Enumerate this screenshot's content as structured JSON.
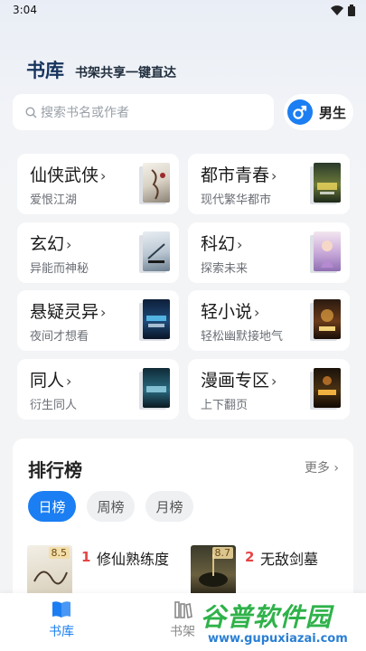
{
  "status": {
    "time": "3:04"
  },
  "header": {
    "title": "书库",
    "slogan": "书架共享一键直达"
  },
  "search": {
    "placeholder": "搜索书名或作者"
  },
  "gender": {
    "label": "男生",
    "symbol": "♂"
  },
  "categories": [
    {
      "name": "仙侠武侠",
      "sub": "爱恨江湖"
    },
    {
      "name": "都市青春",
      "sub": "现代繁华都市"
    },
    {
      "name": "玄幻",
      "sub": "异能而神秘"
    },
    {
      "name": "科幻",
      "sub": "探索未来"
    },
    {
      "name": "悬疑灵异",
      "sub": "夜间才想看"
    },
    {
      "name": "轻小说",
      "sub": "轻松幽默接地气"
    },
    {
      "name": "同人",
      "sub": "衍生同人"
    },
    {
      "name": "漫画专区",
      "sub": "上下翻页"
    }
  ],
  "ranking": {
    "title": "排行榜",
    "more": "更多",
    "tabs": [
      "日榜",
      "周榜",
      "月榜"
    ],
    "books": [
      {
        "rank": "1",
        "title": "修仙熟练度",
        "score": "8.5"
      },
      {
        "rank": "2",
        "title": "无敌剑墓",
        "score": "8.7"
      }
    ]
  },
  "nav": {
    "library": "书库",
    "shelf": "书架"
  },
  "watermark": {
    "main": "谷普软件园",
    "url": "www.gupuxiazai.com"
  },
  "colors": {
    "accent": "#1b7ef2",
    "rank_red": "#e64545",
    "title_navy": "#17345d"
  }
}
